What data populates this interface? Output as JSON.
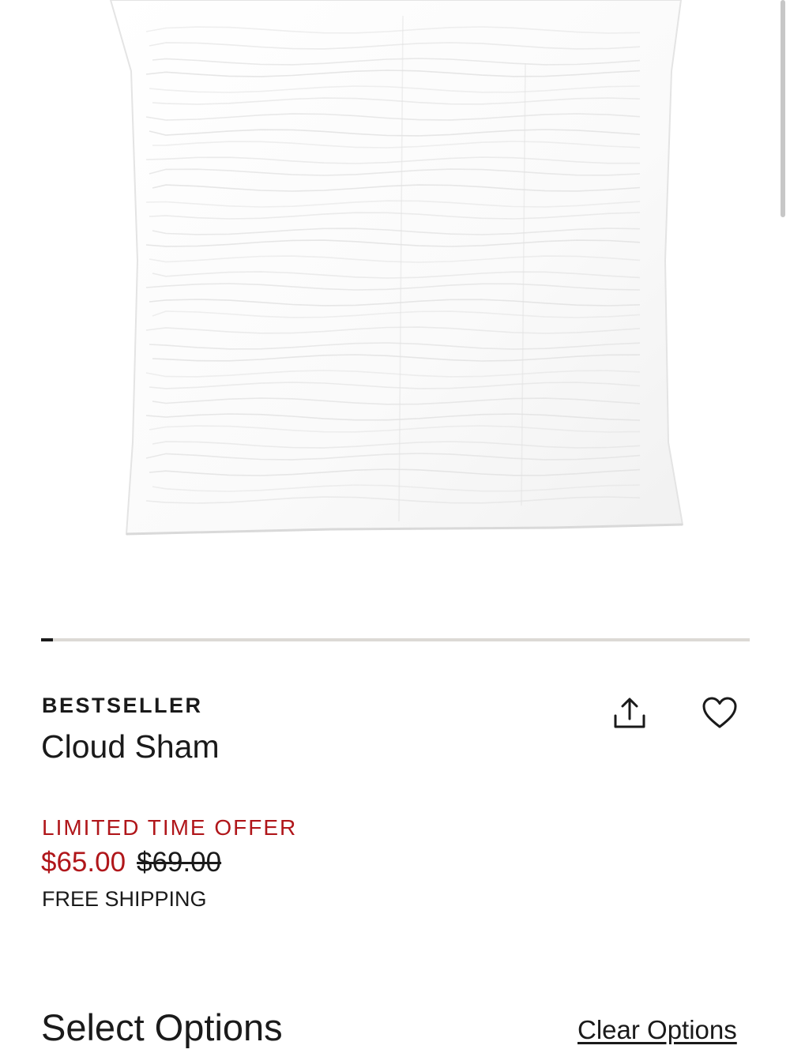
{
  "product": {
    "badge": "BESTSELLER",
    "title": "Cloud Sham",
    "offer_label": "LIMITED TIME OFFER",
    "sale_price": "$65.00",
    "original_price": "$69.00",
    "shipping": "FREE SHIPPING",
    "image_icon": "pillow-sham-photo"
  },
  "gallery": {
    "progress_fraction": 0.017
  },
  "actions": {
    "share_icon": "share-icon",
    "favorite_icon": "heart-icon"
  },
  "options": {
    "heading": "Select Options",
    "clear_label": "Clear Options"
  },
  "colors": {
    "offer_red": "#b0161a",
    "text": "#1a1a1a",
    "track": "#dcd9d5"
  }
}
